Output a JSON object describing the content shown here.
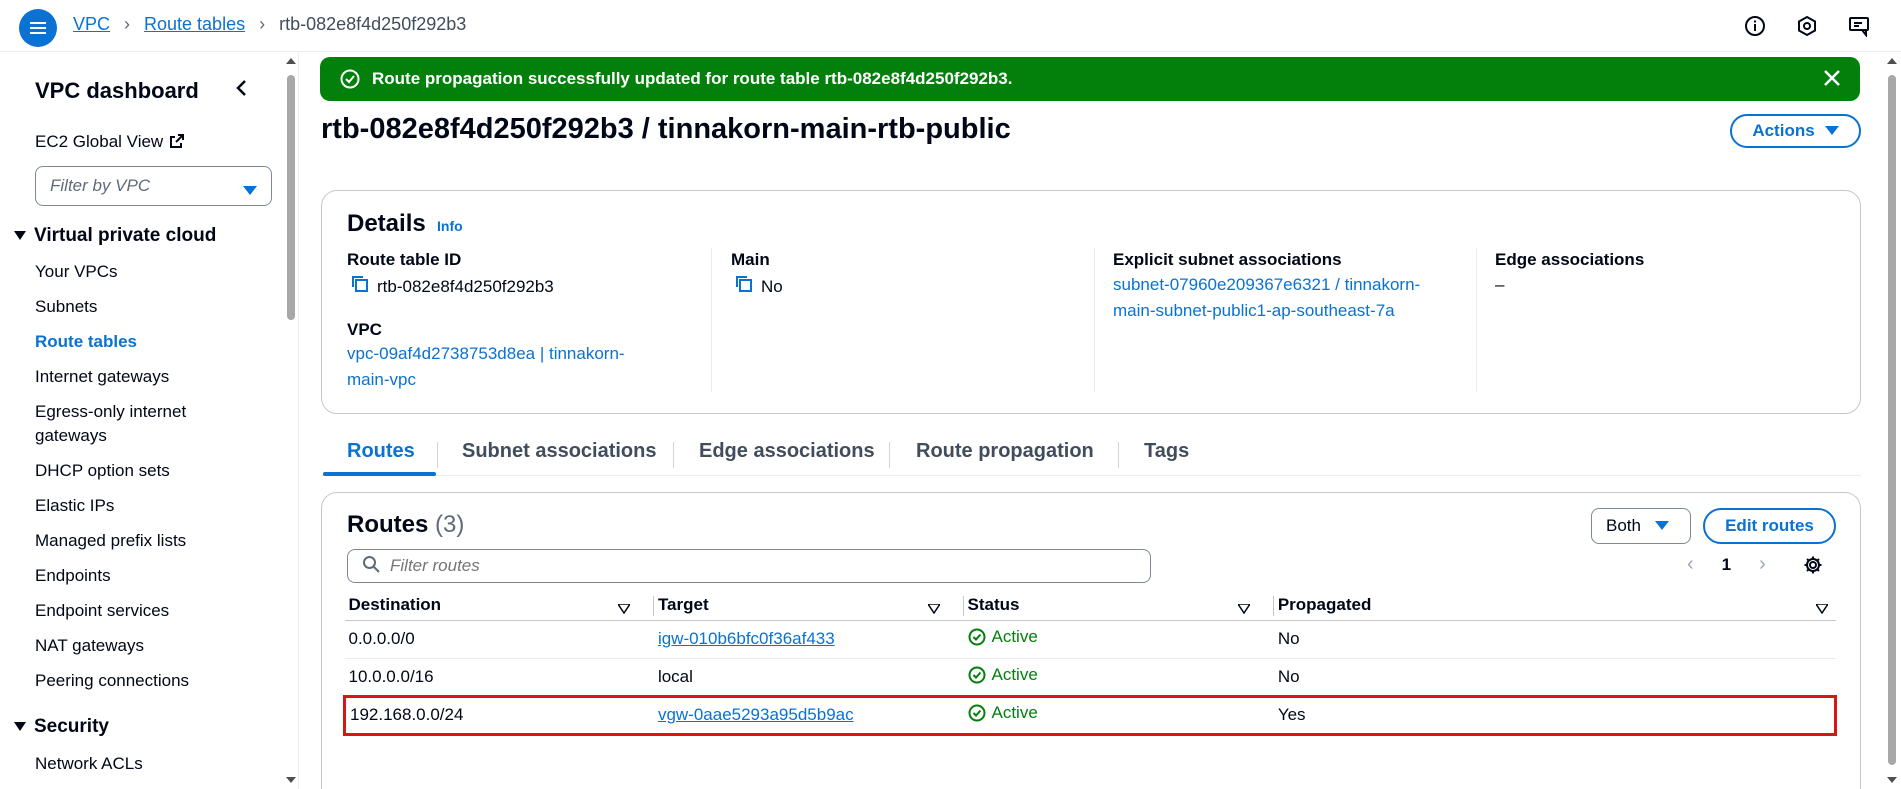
{
  "header": {
    "breadcrumbs": [
      {
        "label": "VPC"
      },
      {
        "label": "Route tables"
      },
      {
        "label": "rtb-082e8f4d250f292b3"
      }
    ]
  },
  "sidebar": {
    "title": "VPC dashboard",
    "ec2_global_view": "EC2 Global View",
    "filter_placeholder": "Filter by VPC",
    "section_vpc": "Virtual private cloud",
    "items": [
      {
        "label": "Your VPCs"
      },
      {
        "label": "Subnets"
      },
      {
        "label": "Route tables"
      },
      {
        "label": "Internet gateways"
      },
      {
        "label": "Egress-only internet"
      },
      {
        "label": "gateways"
      },
      {
        "label": "DHCP option sets"
      },
      {
        "label": "Elastic IPs"
      },
      {
        "label": "Managed prefix lists"
      },
      {
        "label": "Endpoints"
      },
      {
        "label": "Endpoint services"
      },
      {
        "label": "NAT gateways"
      },
      {
        "label": "Peering connections"
      }
    ],
    "section_security": "Security",
    "security_items": [
      {
        "label": "Network ACLs"
      }
    ]
  },
  "flash": {
    "message": "Route propagation successfully updated for route table rtb-082e8f4d250f292b3.",
    "color": "#037f0c"
  },
  "page": {
    "title": "rtb-082e8f4d250f292b3 / tinnakorn-main-rtb-public",
    "actions_label": "Actions"
  },
  "details": {
    "heading": "Details",
    "info": "Info",
    "route_table_id_label": "Route table ID",
    "route_table_id": "rtb-082e8f4d250f292b3",
    "vpc_label": "VPC",
    "vpc_line1": "vpc-09af4d2738753d8ea | tinnakorn-",
    "vpc_line2": "main-vpc",
    "main_label": "Main",
    "main_value": "No",
    "subnet_assoc_label": "Explicit subnet associations",
    "subnet_line1": "subnet-07960e209367e6321 / tinnakorn-",
    "subnet_line2": "main-subnet-public1-ap-southeast-7a",
    "edge_assoc_label": "Edge associations",
    "edge_assoc_value": "–"
  },
  "tabs": [
    {
      "label": "Routes"
    },
    {
      "label": "Subnet associations"
    },
    {
      "label": "Edge associations"
    },
    {
      "label": "Route propagation"
    },
    {
      "label": "Tags"
    }
  ],
  "routes": {
    "heading": "Routes",
    "count": "(3)",
    "filter_value": "Both",
    "edit_label": "Edit routes",
    "search_placeholder": "Filter routes",
    "page": "1",
    "columns": [
      "Destination",
      "Target",
      "Status",
      "Propagated"
    ],
    "rows": [
      {
        "destination": "0.0.0.0/0",
        "target": "igw-010b6bfc0f36af433",
        "status": "Active",
        "propagated": "No"
      },
      {
        "destination": "10.0.0.0/16",
        "target": "local",
        "status": "Active",
        "propagated": "No"
      },
      {
        "destination": "192.168.0.0/24",
        "target": "vgw-0aae5293a95d5b9ac",
        "status": "Active",
        "propagated": "Yes"
      }
    ]
  },
  "colors": {
    "accent": "#0972d3",
    "success": "#037f0c",
    "highlight": "#d91515"
  }
}
